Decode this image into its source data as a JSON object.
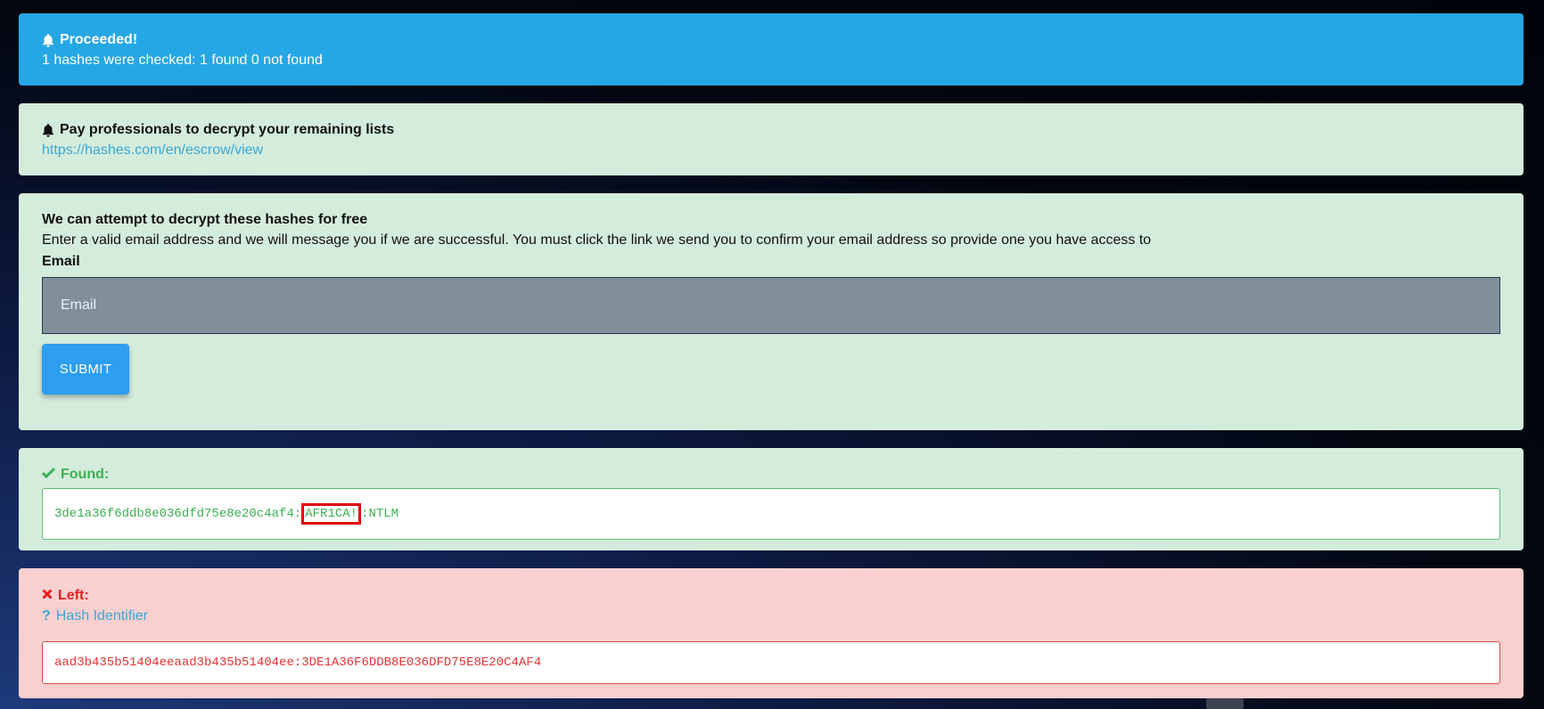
{
  "proceeded": {
    "title": "Proceeded!",
    "message": "1 hashes were checked: 1 found 0 not found",
    "icon": "bell-icon"
  },
  "escrow": {
    "title": "Pay professionals to decrypt your remaining lists",
    "link": "https://hashes.com/en/escrow/view",
    "icon": "bell-icon"
  },
  "free_decrypt": {
    "title": "We can attempt to decrypt these hashes for free",
    "description": "Enter a valid email address and we will message you if we are successful. You must click the link we send you to confirm your email address so provide one you have access to",
    "email_label": "Email",
    "email_placeholder": "Email",
    "email_value": "",
    "submit_label": "SUBMIT"
  },
  "found": {
    "title": "Found:",
    "icon": "check-icon",
    "hash": "3de1a36f6ddb8e036dfd75e8e20c4af4",
    "sep1": ":",
    "plaintext": "AFR1CA!",
    "sep2": ":",
    "algorithm": "NTLM"
  },
  "left": {
    "title": "Left:",
    "icon": "x-icon",
    "hash_identifier_label": "Hash Identifier",
    "hash_identifier_icon": "question-icon",
    "entry": "aad3b435b51404eeaad3b435b51404ee:3DE1A36F6DDB8E036DFD75E8E20C4AF4"
  },
  "colors": {
    "info_blue": "#26a7e5",
    "success_bg": "#d4ecdc",
    "danger_bg": "#f9d0d0",
    "success_text": "#3cb054",
    "danger_text": "#e03535",
    "link": "#3ba7d4",
    "highlight": "#e00000"
  }
}
